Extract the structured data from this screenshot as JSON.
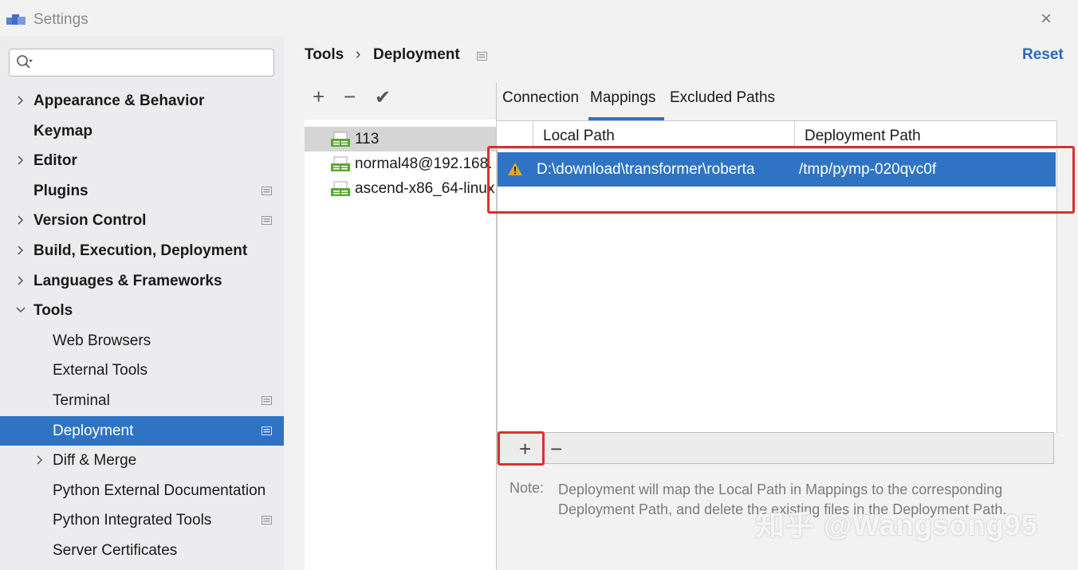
{
  "window": {
    "title": "Settings"
  },
  "search": {
    "placeholder": "",
    "value": ""
  },
  "sidebar": {
    "items": [
      {
        "label": "Appearance & Behavior",
        "expandable": true,
        "expanded": false,
        "bold": true,
        "project": false
      },
      {
        "label": "Keymap",
        "expandable": false,
        "bold": true,
        "project": false
      },
      {
        "label": "Editor",
        "expandable": true,
        "expanded": false,
        "bold": true,
        "project": false
      },
      {
        "label": "Plugins",
        "expandable": false,
        "bold": true,
        "project": true
      },
      {
        "label": "Version Control",
        "expandable": true,
        "expanded": false,
        "bold": true,
        "project": true
      },
      {
        "label": "Build, Execution, Deployment",
        "expandable": true,
        "expanded": false,
        "bold": true,
        "project": false
      },
      {
        "label": "Languages & Frameworks",
        "expandable": true,
        "expanded": false,
        "bold": true,
        "project": false
      },
      {
        "label": "Tools",
        "expandable": true,
        "expanded": true,
        "bold": true,
        "project": false
      },
      {
        "label": "Web Browsers",
        "child": true,
        "project": false
      },
      {
        "label": "External Tools",
        "child": true,
        "project": false
      },
      {
        "label": "Terminal",
        "child": true,
        "project": true
      },
      {
        "label": "Deployment",
        "child": true,
        "project": true,
        "selected": true
      },
      {
        "label": "Diff & Merge",
        "child": true,
        "expandable": true,
        "project": false
      },
      {
        "label": "Python External Documentation",
        "child": true,
        "project": false
      },
      {
        "label": "Python Integrated Tools",
        "child": true,
        "project": true
      },
      {
        "label": "Server Certificates",
        "child": true,
        "project": false
      }
    ]
  },
  "breadcrumb": {
    "parent": "Tools",
    "separator": "›",
    "current": "Deployment"
  },
  "reset_label": "Reset",
  "server_toolbar": {
    "add": "+",
    "remove": "−",
    "check": "✔"
  },
  "servers": [
    {
      "name": "113",
      "selected": true
    },
    {
      "name": "normal48@192.168.",
      "selected": false
    },
    {
      "name": "ascend-x86_64-linux",
      "selected": false
    }
  ],
  "tabs": [
    {
      "label": "Connection",
      "active": false
    },
    {
      "label": "Mappings",
      "active": true
    },
    {
      "label": "Excluded Paths",
      "active": false
    }
  ],
  "table": {
    "headers": {
      "local": "Local Path",
      "deployment": "Deployment Path"
    },
    "rows": [
      {
        "local": "D:\\download\\transformer\\roberta",
        "deployment": "/tmp/pymp-020qvc0f",
        "warning": true,
        "selected": true
      }
    ]
  },
  "table_toolbar": {
    "add": "+",
    "remove": "−"
  },
  "note": {
    "label": "Note:",
    "text": "Deployment will map the Local Path in Mappings to the corresponding Deployment Path, and delete the existing files in the Deployment Path."
  },
  "watermark": "知乎 @Wangsong95",
  "colors": {
    "accent": "#2f74c4",
    "highlight_box": "#d8322c",
    "link": "#2a6ab6",
    "warning": "#e0a534"
  }
}
